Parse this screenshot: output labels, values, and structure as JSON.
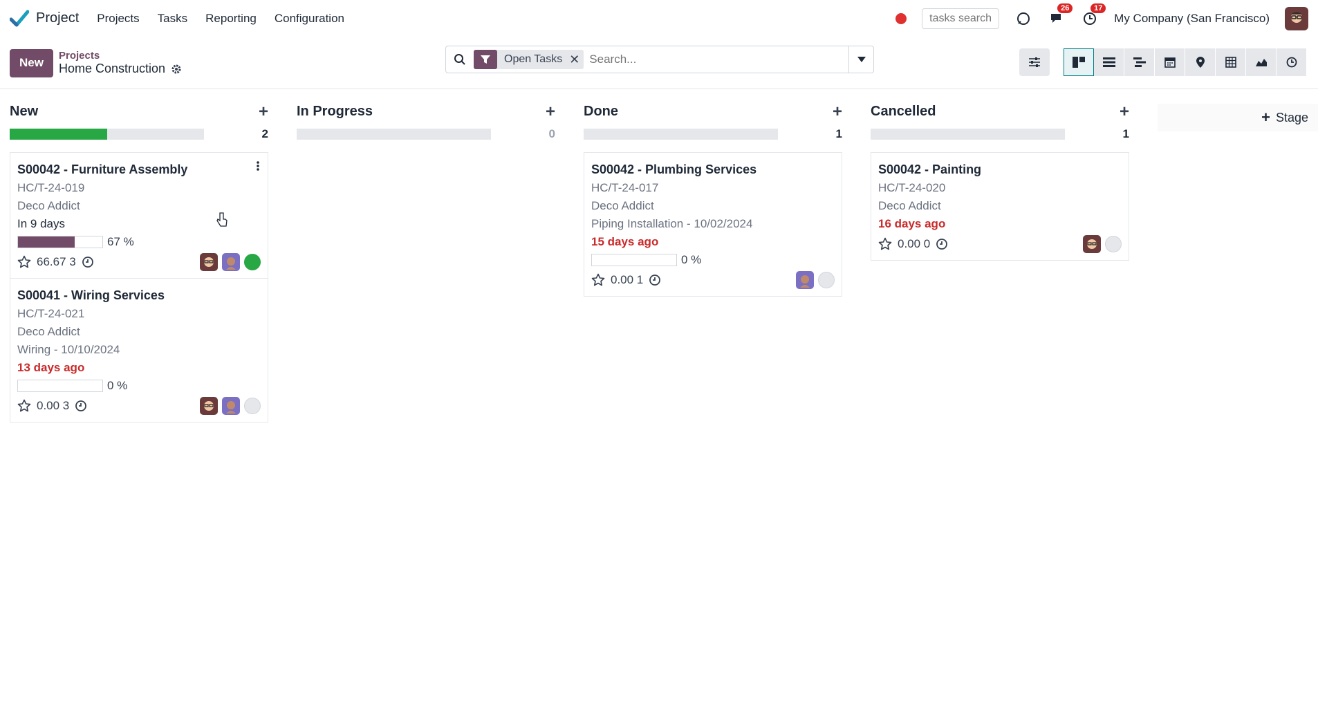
{
  "navbar": {
    "app_name": "Project",
    "menu": [
      "Projects",
      "Tasks",
      "Reporting",
      "Configuration"
    ],
    "tasks_search_placeholder": "tasks search",
    "messages_count": "26",
    "activities_count": "17",
    "company": "My Company (San Francisco)"
  },
  "control": {
    "new_label": "New",
    "breadcrumb_parent": "Projects",
    "breadcrumb_current": "Home Construction",
    "facet_label": "Open Tasks",
    "search_placeholder": "Search..."
  },
  "add_stage_label": "Stage",
  "columns": [
    {
      "title": "New",
      "count": "2",
      "progress": 0.5,
      "cards": [
        {
          "title": "S00042 - Furniture Assembly",
          "ref": "HC/T-24-019",
          "customer": "Deco Addict",
          "date": "In 9 days",
          "date_late": false,
          "progress": 67,
          "progress_label": "67 %",
          "meta": "66.67 3",
          "state": "green"
        },
        {
          "title": "S00041 - Wiring Services",
          "ref": "HC/T-24-021",
          "customer": "Deco Addict",
          "milestone": "Wiring - 10/10/2024",
          "date": "13 days ago",
          "date_late": true,
          "progress": 0,
          "progress_label": "0 %",
          "meta": "0.00 3",
          "state": "grey"
        }
      ]
    },
    {
      "title": "In Progress",
      "count": "0",
      "progress": 0,
      "cards": []
    },
    {
      "title": "Done",
      "count": "1",
      "progress": 0,
      "cards": [
        {
          "title": "S00042 - Plumbing Services",
          "ref": "HC/T-24-017",
          "customer": "Deco Addict",
          "milestone": "Piping Installation - 10/02/2024",
          "date": "15 days ago",
          "date_late": true,
          "progress": 0,
          "progress_label": "0 %",
          "meta": "0.00 1",
          "state": "grey"
        }
      ]
    },
    {
      "title": "Cancelled",
      "count": "1",
      "progress": 0,
      "cards": [
        {
          "title": "S00042 - Painting",
          "ref": "HC/T-24-020",
          "customer": "Deco Addict",
          "date": "16 days ago",
          "date_late": true,
          "meta": "0.00 0",
          "state": "grey"
        }
      ]
    }
  ]
}
